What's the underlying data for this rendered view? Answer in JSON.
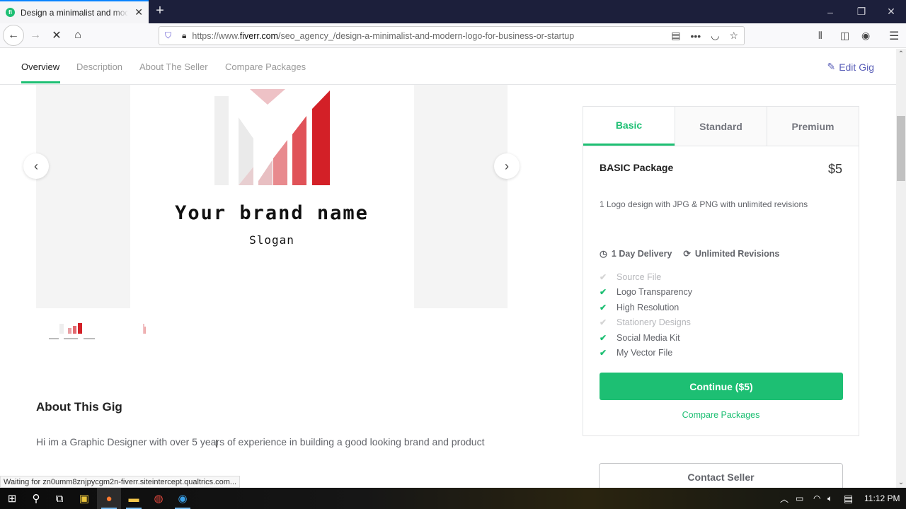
{
  "browser": {
    "tab_title": "Design a minimalist and modern logo for business or startup",
    "tab_favicon": "fi",
    "new_tab": "+",
    "url_domain_prefix": "https://www.",
    "url_domain": "fiverr.com",
    "url_path": "/seo_agency_/design-a-minimalist-and-modern-logo-for-business-or-startup",
    "window_controls": {
      "minimize": "–",
      "restore": "❐",
      "close": "✕"
    }
  },
  "gig_nav": {
    "items": [
      "Overview",
      "Description",
      "About The Seller",
      "Compare Packages"
    ],
    "active_index": 0,
    "edit_label": "Edit Gig"
  },
  "gallery": {
    "brand_name": "Your brand name",
    "slogan": "Slogan",
    "prev": "‹",
    "next": "›"
  },
  "about": {
    "title": "About This Gig",
    "text": "Hi im a Graphic Designer with over 5 years of experience in building a good looking brand and product"
  },
  "packages": {
    "tabs": [
      "Basic",
      "Standard",
      "Premium"
    ],
    "active_index": 0,
    "title": "BASIC Package",
    "price": "$5",
    "description": "1 Logo design with JPG & PNG with unlimited revisions",
    "delivery": "1 Day Delivery",
    "revisions": "Unlimited Revisions",
    "features": [
      {
        "label": "Source File",
        "included": false
      },
      {
        "label": "Logo Transparency",
        "included": true
      },
      {
        "label": "High Resolution",
        "included": true
      },
      {
        "label": "Stationery Designs",
        "included": false
      },
      {
        "label": "Social Media Kit",
        "included": true
      },
      {
        "label": "My Vector File",
        "included": true
      }
    ],
    "continue_label": "Continue ($5)",
    "compare_label": "Compare Packages",
    "contact_label": "Contact Seller"
  },
  "status_text": "Waiting for zn0umm8znjpycgm2n-fiverr.siteintercept.qualtrics.com...",
  "taskbar": {
    "clock": "11:12 PM"
  },
  "colors": {
    "accent_green": "#1dbf73",
    "edit_link": "#5a5fb8",
    "tabstrip": "#1c1f3b",
    "logo_red": "#d32027"
  }
}
